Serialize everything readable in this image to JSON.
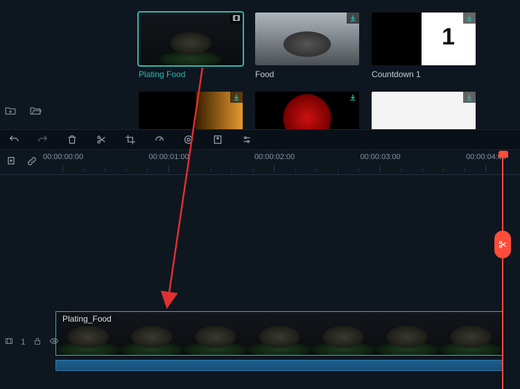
{
  "media": {
    "items": [
      {
        "label": "Plating Food",
        "selected": true,
        "badge": "video"
      },
      {
        "label": "Food",
        "selected": false,
        "badge": "download"
      },
      {
        "label": "Countdown 1",
        "selected": false,
        "badge": "download"
      }
    ],
    "row2_badges": [
      "download",
      "download",
      "download"
    ]
  },
  "toolbar": {
    "undo": "Undo",
    "redo": "Redo",
    "delete": "Delete",
    "cut": "Split",
    "crop": "Crop",
    "speed": "Speed",
    "color": "Color",
    "export": "Export",
    "adjust": "Adjust"
  },
  "timeline": {
    "marker_btn": "Add Marker",
    "link_btn": "Link",
    "ticks": [
      "00:00:00:00",
      "00:00:01:00",
      "00:00:02:00",
      "00:00:03:00",
      "00:00:04:00"
    ],
    "clip_name": "Plating_Food",
    "track_label": "1"
  },
  "colors": {
    "accent": "#2fb9b1",
    "playhead": "#ff4d3a"
  }
}
